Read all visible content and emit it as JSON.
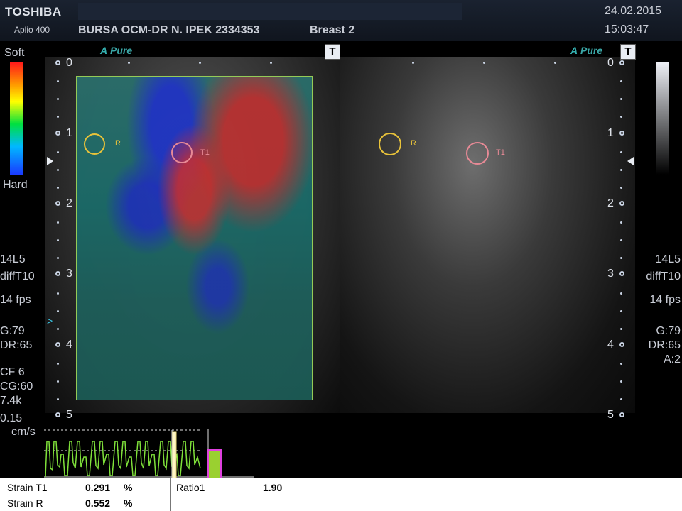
{
  "header": {
    "brand": "TOSHIBA",
    "model": "Aplio 400",
    "patient": "BURSA OCM-DR N. IPEK  2334353",
    "preset": "Breast 2",
    "date": "24.02.2015",
    "time": "15:03:47"
  },
  "left_panel": {
    "soft_label": "Soft",
    "hard_label": "Hard",
    "probe": "14L5",
    "mode": "diffT10",
    "fps": "14 fps",
    "gain": "G:79",
    "dr": "DR:65",
    "cf": "CF 6",
    "cg": "CG:60",
    "freq": "7.4k",
    "vel": "0.15",
    "vel_unit": "cm/s"
  },
  "right_panel": {
    "probe": "14L5",
    "mode": "diffT10",
    "fps": "14 fps",
    "gain": "G:79",
    "dr": "DR:65",
    "a": "A:2"
  },
  "apure_left": "Pure",
  "apure_right": "Pure",
  "t_button": "T",
  "depth_labels": [
    "0",
    "1",
    "2",
    "3",
    "4",
    "5"
  ],
  "roi": {
    "ref_label": "R",
    "target_label": "T1",
    "ref_color": "#e8c23a",
    "target_color": "#e88a96"
  },
  "strain_table": {
    "t1_label": "Strain T1",
    "t1_value": "0.291",
    "t1_unit": "%",
    "r_label": "Strain R",
    "r_value": "0.552",
    "r_unit": "%",
    "ratio_label": "Ratio1",
    "ratio_value": "1.90"
  }
}
